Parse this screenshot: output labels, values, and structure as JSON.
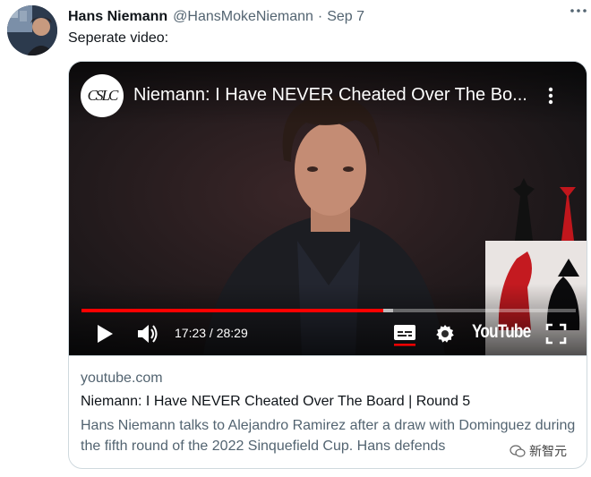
{
  "tweet": {
    "author_name": "Hans Niemann",
    "handle": "@HansMokeNiemann",
    "separator": "·",
    "date": "Sep 7",
    "text": "Seperate video:"
  },
  "video": {
    "channel_logo_text": "CSLC",
    "title": "Niemann: I Have NEVER Cheated Over The Bo...",
    "time": "17:23 / 28:29",
    "progress_fraction": 0.61,
    "buffered_fraction": 0.63,
    "youtube_label": "YouTube"
  },
  "card": {
    "domain": "youtube.com",
    "title": "Niemann: I Have NEVER Cheated Over The Board | Round 5",
    "description": "Hans Niemann talks to Alejandro Ramirez after a draw with Dominguez during the fifth round of the 2022 Sinquefield Cup. Hans defends"
  },
  "watermark": {
    "text": "新智元"
  },
  "colors": {
    "progress_red": "#ff0000",
    "secondary_text": "#536471",
    "border": "#cfd9de"
  }
}
